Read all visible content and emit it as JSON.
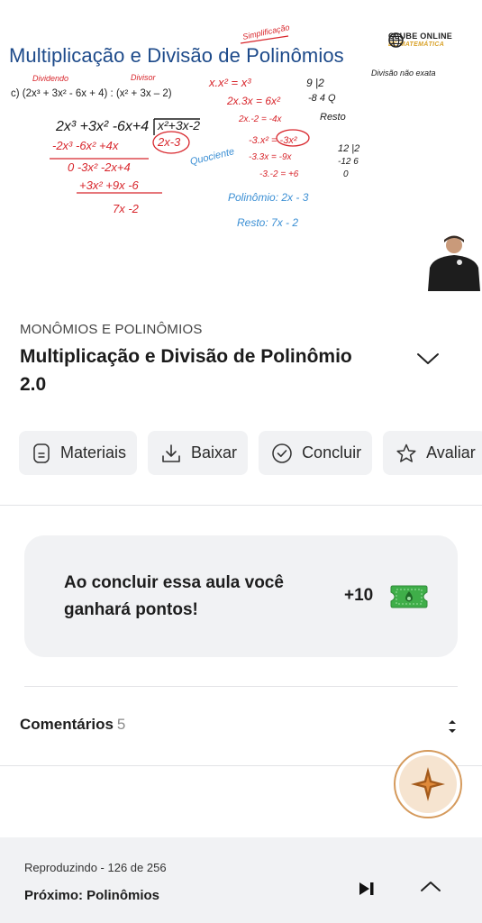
{
  "video": {
    "heading": "Multiplicação e Divisão de Polinômios",
    "brand_line1": "CLUBE ONLINE",
    "brand_line2": "DE MATEMÁTICA",
    "exercise": "c) (2x³ + 3x² - 6x + 4) : (x² + 3x – 2)",
    "notes": {
      "dividendo": "Dividendo",
      "divisor": "Divisor",
      "simplificacao": "Simplificação",
      "quociente": "Quociente",
      "divisao_nao_exata": "Divisão não exata",
      "resto": "Resto",
      "polinomio": "Polinômio: 2x - 3",
      "resto_final": "Resto: 7x - 2"
    }
  },
  "lesson": {
    "category": "MONÔMIOS E POLINÔMIOS",
    "title": "Multiplicação e Divisão de Polinômio 2.0"
  },
  "actions": [
    {
      "label": "Materiais",
      "icon": "document-icon"
    },
    {
      "label": "Baixar",
      "icon": "download-icon"
    },
    {
      "label": "Concluir",
      "icon": "check-circle-icon"
    },
    {
      "label": "Avaliar",
      "icon": "star-outline-icon"
    }
  ],
  "points_card": {
    "message": "Ao concluir essa aula você ganhará pontos!",
    "points": "+10",
    "icon": "ticket-icon",
    "icon_color": "#3fae49"
  },
  "comments": {
    "label": "Comentários",
    "count": "5"
  },
  "player": {
    "playing": "Reproduzindo - 126 de 256",
    "next": "Próximo: Polinômios"
  },
  "colors": {
    "accent_orange": "#d59a5c",
    "ink_red": "#d8262c",
    "ink_blue": "#3b8fd4",
    "heading_blue": "#1d4a8a"
  }
}
